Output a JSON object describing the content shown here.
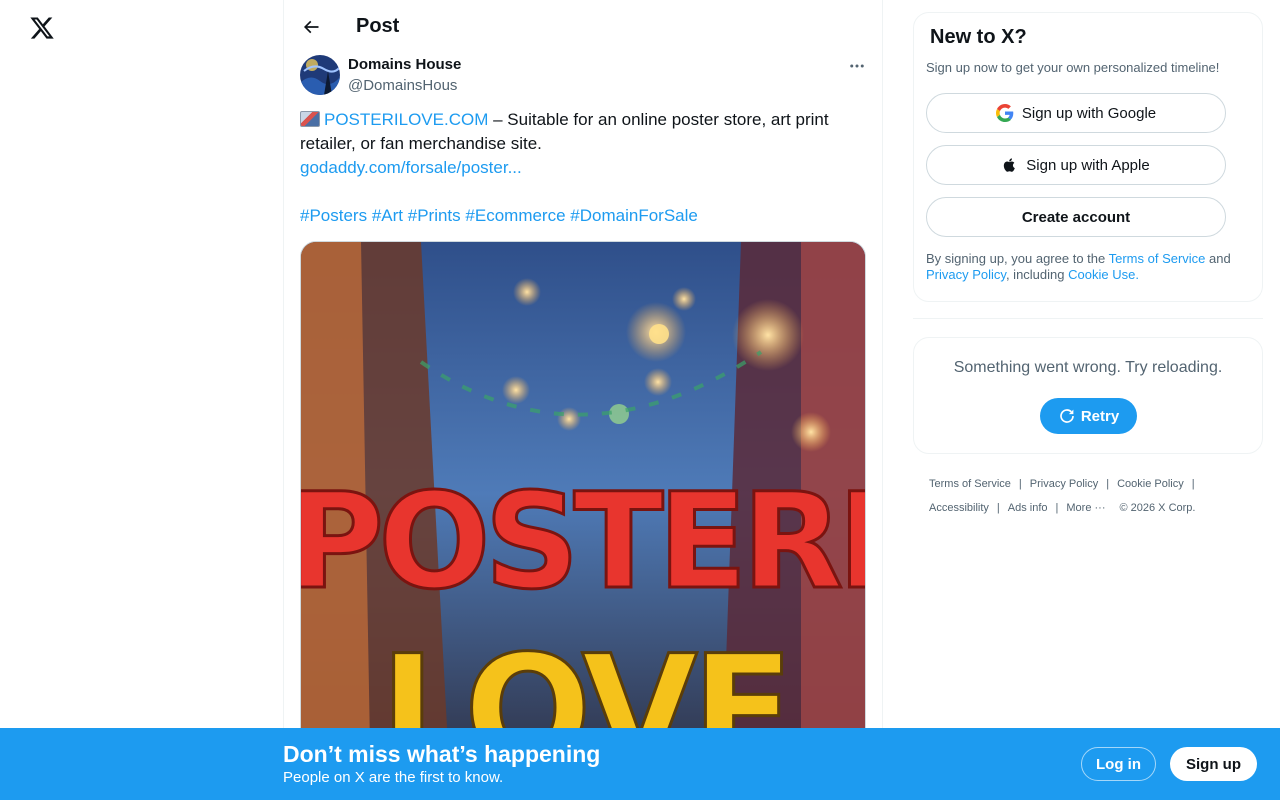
{
  "nav": {
    "logo_icon": "x-logo-icon"
  },
  "header": {
    "title": "Post",
    "back_icon": "arrow-left-icon"
  },
  "post": {
    "author_name": "Domains House",
    "author_handle": "@DomainsHous",
    "emoji_icon": "framed-picture-icon",
    "domain_link": "POSTERILOVE.COM",
    "text_after_domain": " – Suitable for an online poster store, art print",
    "text_line2": "retailer, or fan merchandise site.",
    "url": "godaddy.com/forsale/poster...",
    "hashtags": [
      "#Posters",
      "#Art",
      "#Prints",
      "#Ecommerce",
      "#DomainForSale"
    ],
    "image_text_line1": "POSTERI",
    "image_text_line2": "LOVE"
  },
  "sidebar": {
    "signup_title": "New to X?",
    "signup_sub": "Sign up now to get your own personalized timeline!",
    "google_label": "Sign up with Google",
    "apple_label": "Sign up with Apple",
    "create_label": "Create account",
    "legal_prefix": "By signing up, you agree to the ",
    "terms_link": "Terms of Service",
    "legal_and": " and",
    "privacy_link": "Privacy Policy",
    "legal_including": ", including ",
    "cookie_link": "Cookie Use",
    "legal_end": ".",
    "error_msg": "Something went wrong. Try reloading.",
    "retry_label": "Retry"
  },
  "footer": {
    "links": [
      "Terms of Service",
      "Privacy Policy",
      "Cookie Policy",
      "Accessibility",
      "Ads info",
      "More ···"
    ],
    "copyright": "© 2026 X Corp."
  },
  "bottom_bar": {
    "title": "Don’t miss what’s happening",
    "subtitle": "People on X are the first to know.",
    "login_label": "Log in",
    "signup_label": "Sign up"
  },
  "colors": {
    "accent": "#1d9bf0",
    "text": "#0f1419",
    "muted": "#536471",
    "border": "#eff3f4"
  }
}
